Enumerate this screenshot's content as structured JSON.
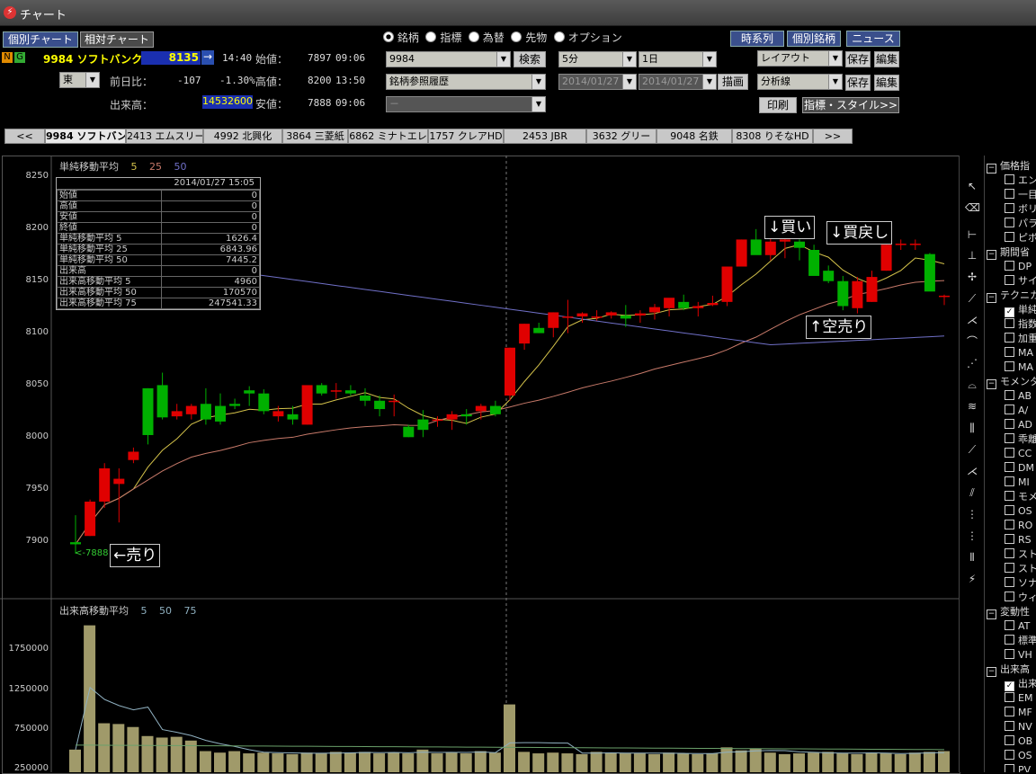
{
  "window": {
    "title": "チャート"
  },
  "tabs": {
    "individual": "個別チャート",
    "relative": "相対チャート"
  },
  "quote": {
    "flag_n": "N",
    "flag_g": "G",
    "code_name": "9984 ソフトバンク",
    "price": "8135",
    "arrow": "→",
    "time": "14:40",
    "open_label": "始値：",
    "open": "7897",
    "open_time": "09:06",
    "market": "東",
    "change_label": "前日比：",
    "change": "-107",
    "change_pct": "-1.30%",
    "high_label": "高値：",
    "high": "8200",
    "high_time": "13:50",
    "volume_label": "出来高：",
    "volume": "14532600",
    "low_label": "安値：",
    "low": "7888",
    "low_time": "09:06"
  },
  "search": {
    "radios": [
      "銘柄",
      "指標",
      "為替",
      "先物",
      "オプション"
    ],
    "code": "9984",
    "search_button": "検索",
    "history": "銘柄参照履歴",
    "third": "－"
  },
  "period": {
    "interval": "5分",
    "span": "1日",
    "date_from": "2014/01/27",
    "date_to": "2014/01/27",
    "draw_button": "描画"
  },
  "right_buttons": {
    "timeseries": "時系列",
    "stock_info": "個別銘柄",
    "news": "ニュース",
    "layout": "レイアウト",
    "save1": "保存",
    "edit1": "編集",
    "analysis": "分析線",
    "save2": "保存",
    "edit2": "編集",
    "print": "印刷",
    "indicator_style": "指標・スタイル>>"
  },
  "stock_tabs": [
    "<<",
    "9984 ソフトバンク",
    "2413 エムスリー",
    "4992 北興化",
    "3864 三菱紙",
    "6862 ミナトエレ",
    "1757 クレアHD",
    "2453 JBR",
    "3632 グリー",
    "9048 名鉄",
    "8308 りそなHD",
    ">>"
  ],
  "main_chart": {
    "legend_title": "単純移動平均",
    "legend_periods": [
      "5",
      "25",
      "50"
    ],
    "legend_colors": [
      "#d4c24a",
      "#c87a6a",
      "#7070c8"
    ],
    "y_ticks": [
      "8250",
      "8200",
      "8150",
      "8100",
      "8050",
      "8000",
      "7950",
      "7900"
    ],
    "low_marker": "<-7888",
    "annotations": {
      "sell": "←売り",
      "buy": "↓買い",
      "buyback": "↓買戻し",
      "short": "↑空売り"
    }
  },
  "tooltip": {
    "datetime": "2014/01/27 15:05",
    "rows": [
      {
        "k": "始値",
        "v": "0"
      },
      {
        "k": "高値",
        "v": "0"
      },
      {
        "k": "安値",
        "v": "0"
      },
      {
        "k": "終値",
        "v": "0"
      },
      {
        "k": "単純移動平均 5",
        "v": "1626.4"
      },
      {
        "k": "単純移動平均 25",
        "v": "6843.96"
      },
      {
        "k": "単純移動平均 50",
        "v": "7445.2"
      },
      {
        "k": "出来高",
        "v": "0"
      },
      {
        "k": "出来高移動平均 5",
        "v": "4960"
      },
      {
        "k": "出来高移動平均 50",
        "v": "170570"
      },
      {
        "k": "出来高移動平均 75",
        "v": "247541.33"
      }
    ]
  },
  "volume_chart": {
    "legend_title": "出来高移動平均",
    "legend_periods": [
      "5",
      "50",
      "75"
    ],
    "y_ticks": [
      "1750000",
      "1250000",
      "750000",
      "250000"
    ]
  },
  "chart_data": {
    "type": "candlestick",
    "x_label": "",
    "y_label": "",
    "ylim": [
      7850,
      8270
    ],
    "up_color": "#e00000",
    "down_color": "#00b000",
    "candles": [
      [
        7899,
        7925,
        7888,
        7897
      ],
      [
        7905,
        7940,
        7905,
        7938
      ],
      [
        7938,
        7975,
        7932,
        7970
      ],
      [
        7955,
        7970,
        7918,
        7960
      ],
      [
        7978,
        7990,
        7975,
        7986
      ],
      [
        8047,
        8047,
        7993,
        8002
      ],
      [
        8050,
        8062,
        8017,
        8019
      ],
      [
        8020,
        8032,
        8017,
        8025
      ],
      [
        8022,
        8032,
        8017,
        8030
      ],
      [
        8032,
        8047,
        8012,
        8017
      ],
      [
        8030,
        8042,
        8012,
        8015
      ],
      [
        8032,
        8037,
        8027,
        8030
      ],
      [
        8045,
        8049,
        8030,
        8042
      ],
      [
        8042,
        8046,
        8022,
        8025
      ],
      [
        8020,
        8030,
        8015,
        8025
      ],
      [
        8022,
        8030,
        8012,
        8017
      ],
      [
        8012,
        8035,
        8012,
        8050
      ],
      [
        8050,
        8052,
        8040,
        8042
      ],
      [
        8045,
        8052,
        8037,
        8045
      ],
      [
        8045,
        8050,
        8040,
        8042
      ],
      [
        8040,
        8047,
        8030,
        8035
      ],
      [
        8035,
        8040,
        8020,
        8027
      ],
      [
        8035,
        8041,
        8020,
        8035
      ],
      [
        8010,
        8012,
        8000,
        8000
      ],
      [
        8017,
        8026,
        8000,
        8007
      ],
      [
        8017,
        8020,
        8010,
        8017
      ],
      [
        8017,
        8025,
        8007,
        8022
      ],
      [
        8022,
        8027,
        8012,
        8020
      ],
      [
        8025,
        8032,
        8017,
        8030
      ],
      [
        8030,
        8035,
        8020,
        8022
      ],
      [
        8040,
        8086,
        8035,
        8086
      ],
      [
        8090,
        8109,
        8084,
        8109
      ],
      [
        8105,
        8110,
        8100,
        8100
      ],
      [
        8105,
        8120,
        8096,
        8120
      ],
      [
        8116,
        8132,
        8100,
        8116
      ],
      [
        8116,
        8120,
        8110,
        8119
      ],
      [
        8116,
        8122,
        8112,
        8116
      ],
      [
        8117,
        8121,
        8114,
        8120
      ],
      [
        8117,
        8127,
        8106,
        8114
      ],
      [
        8117,
        8122,
        8110,
        8119
      ],
      [
        8120,
        8128,
        8113,
        8125
      ],
      [
        8124,
        8133,
        8116,
        8134
      ],
      [
        8130,
        8137,
        8122,
        8124
      ],
      [
        8124,
        8130,
        8116,
        8126
      ],
      [
        8127,
        8136,
        8126,
        8129
      ],
      [
        8130,
        8164,
        8126,
        8164
      ],
      [
        8164,
        8190,
        8164,
        8190
      ],
      [
        8190,
        8200,
        8176,
        8175
      ],
      [
        8175,
        8192,
        8170,
        8188
      ],
      [
        8188,
        8195,
        8172,
        8190
      ],
      [
        8188,
        8190,
        8170,
        8182
      ],
      [
        8180,
        8185,
        8162,
        8155
      ],
      [
        8160,
        8165,
        8148,
        8150
      ],
      [
        8150,
        8155,
        8122,
        8126
      ],
      [
        8124,
        8154,
        8119,
        8150
      ],
      [
        8130,
        8160,
        8130,
        8154
      ],
      [
        8160,
        8185,
        8160,
        8185
      ],
      [
        8186,
        8190,
        8180,
        8186
      ],
      [
        8186,
        8190,
        8180,
        8186
      ],
      [
        8176,
        8177,
        8143,
        8140
      ],
      [
        8136,
        8137,
        8127,
        8136
      ]
    ],
    "volume": [
      300000,
      1950000,
      650000,
      640000,
      600000,
      480000,
      460000,
      470000,
      420000,
      280000,
      260000,
      280000,
      250000,
      260000,
      250000,
      240000,
      260000,
      250000,
      270000,
      260000,
      270000,
      250000,
      260000,
      250000,
      300000,
      250000,
      260000,
      250000,
      280000,
      260000,
      900000,
      270000,
      250000,
      260000,
      250000,
      240000,
      270000,
      260000,
      250000,
      250000,
      240000,
      260000,
      250000,
      240000,
      250000,
      330000,
      290000,
      310000,
      260000,
      240000,
      250000,
      260000,
      270000,
      250000,
      240000,
      260000,
      250000,
      240000,
      260000,
      270000,
      280000
    ]
  },
  "sidebar": {
    "groups": [
      {
        "name": "価格指",
        "items": [
          "エン",
          "一目",
          "ボリ",
          "パラ",
          "ピボ"
        ]
      },
      {
        "name": "期間省",
        "items": [
          "DP",
          "サイ"
        ]
      },
      {
        "name": "テクニカ",
        "items": [
          "単純",
          "指数",
          "加重",
          "MA",
          "MA"
        ]
      },
      {
        "name": "モメンタ",
        "items": [
          "AB",
          "A/",
          "AD",
          "乖離",
          "CC",
          "DM",
          "MI",
          "モメ",
          "OS",
          "RO",
          "RS",
          "スト",
          "スト",
          "ソナ",
          "ウィ"
        ]
      },
      {
        "name": "変動性",
        "items": [
          "AT",
          "標準",
          "VH"
        ]
      },
      {
        "name": "出来高",
        "items": [
          "出来",
          "EM",
          "MF",
          "NV",
          "OB",
          "OS",
          "PV"
        ]
      }
    ]
  }
}
